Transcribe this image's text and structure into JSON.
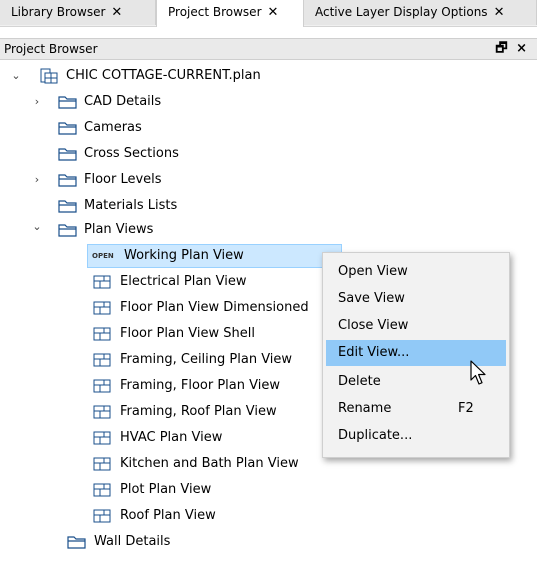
{
  "tabs": [
    {
      "label": "Library Browser",
      "close": "✕"
    },
    {
      "label": "Project Browser",
      "close": "✕"
    },
    {
      "label": "Active Layer Display Options",
      "close": "✕"
    }
  ],
  "panel": {
    "title": "Project Browser",
    "pin": "🗗 ×"
  },
  "tree": {
    "root": {
      "label": "CHIC COTTAGE-CURRENT.plan",
      "expanded": true
    },
    "folders": [
      {
        "label": "CAD Details",
        "collapsed_chevron": "›"
      },
      {
        "label": "Cameras"
      },
      {
        "label": "Cross Sections"
      },
      {
        "label": "Floor Levels",
        "collapsed_chevron": "›"
      },
      {
        "label": "Materials Lists"
      },
      {
        "label": "Plan Views",
        "expanded_chevron": "⌄"
      }
    ],
    "plan_views": [
      {
        "label": "Working Plan View",
        "badge": "OPEN"
      },
      {
        "label": "Electrical Plan View"
      },
      {
        "label": "Floor Plan View Dimensioned"
      },
      {
        "label": "Floor Plan View Shell"
      },
      {
        "label": "Framing, Ceiling Plan View"
      },
      {
        "label": "Framing, Floor Plan View"
      },
      {
        "label": "Framing, Roof Plan View"
      },
      {
        "label": "HVAC Plan View"
      },
      {
        "label": "Kitchen and Bath Plan View"
      },
      {
        "label": "Plot Plan View"
      },
      {
        "label": "Roof Plan View"
      }
    ],
    "last_folder": {
      "label": "Wall Details"
    }
  },
  "context_menu": {
    "items": [
      {
        "label": "Open View",
        "shortcut": ""
      },
      {
        "label": "Save View",
        "shortcut": ""
      },
      {
        "label": "Close View",
        "shortcut": ""
      },
      {
        "label": "Edit View...",
        "shortcut": "",
        "highlighted": true
      },
      {
        "label": "Delete",
        "shortcut": ""
      },
      {
        "label": "Rename",
        "shortcut": "F2"
      },
      {
        "label": "Duplicate...",
        "shortcut": ""
      }
    ]
  },
  "colors": {
    "selection": "#cce8ff",
    "menu_highlight": "#91c9f7",
    "folder": "#1a4f8b"
  },
  "icons": {
    "folder": "folder-icon",
    "plan": "plan-view-icon",
    "file": "plan-file-icon",
    "cursor": "mouse-pointer-icon"
  }
}
